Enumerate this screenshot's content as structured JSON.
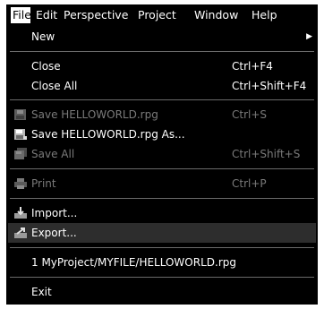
{
  "menubar": {
    "file": "File",
    "edit": "Edit",
    "perspective": "Perspective",
    "project": "Project",
    "window": "Window",
    "help": "Help"
  },
  "file_menu": {
    "new": {
      "label": "New",
      "submenu_icon": "submenu-arrow-icon"
    },
    "close": {
      "label": "Close",
      "shortcut": "Ctrl+F4"
    },
    "close_all": {
      "label": "Close All",
      "shortcut": "Ctrl+Shift+F4"
    },
    "save": {
      "label": "Save HELLOWORLD.rpg",
      "shortcut": "Ctrl+S",
      "icon": "floppy-disk-icon",
      "enabled": false
    },
    "save_as": {
      "label": "Save HELLOWORLD.rpg As...",
      "icon": "floppy-disk-as-icon",
      "enabled": true
    },
    "save_all": {
      "label": "Save All",
      "shortcut": "Ctrl+Shift+S",
      "icon": "multiple-floppy-icon",
      "enabled": false
    },
    "print": {
      "label": "Print",
      "shortcut": "Ctrl+P",
      "icon": "printer-icon",
      "enabled": false
    },
    "import": {
      "label": "Import...",
      "icon": "import-icon"
    },
    "export": {
      "label": "Export...",
      "icon": "export-icon",
      "selected": true
    },
    "recent_1": {
      "label": "1 MyProject/MYFILE/HELLOWORLD.rpg"
    },
    "exit": {
      "label": "Exit"
    }
  },
  "colors": {
    "menu_background": "#000000",
    "text": "#ffffff",
    "disabled_text": "#7a7a7a",
    "selected_background": "#2d2d2d"
  }
}
